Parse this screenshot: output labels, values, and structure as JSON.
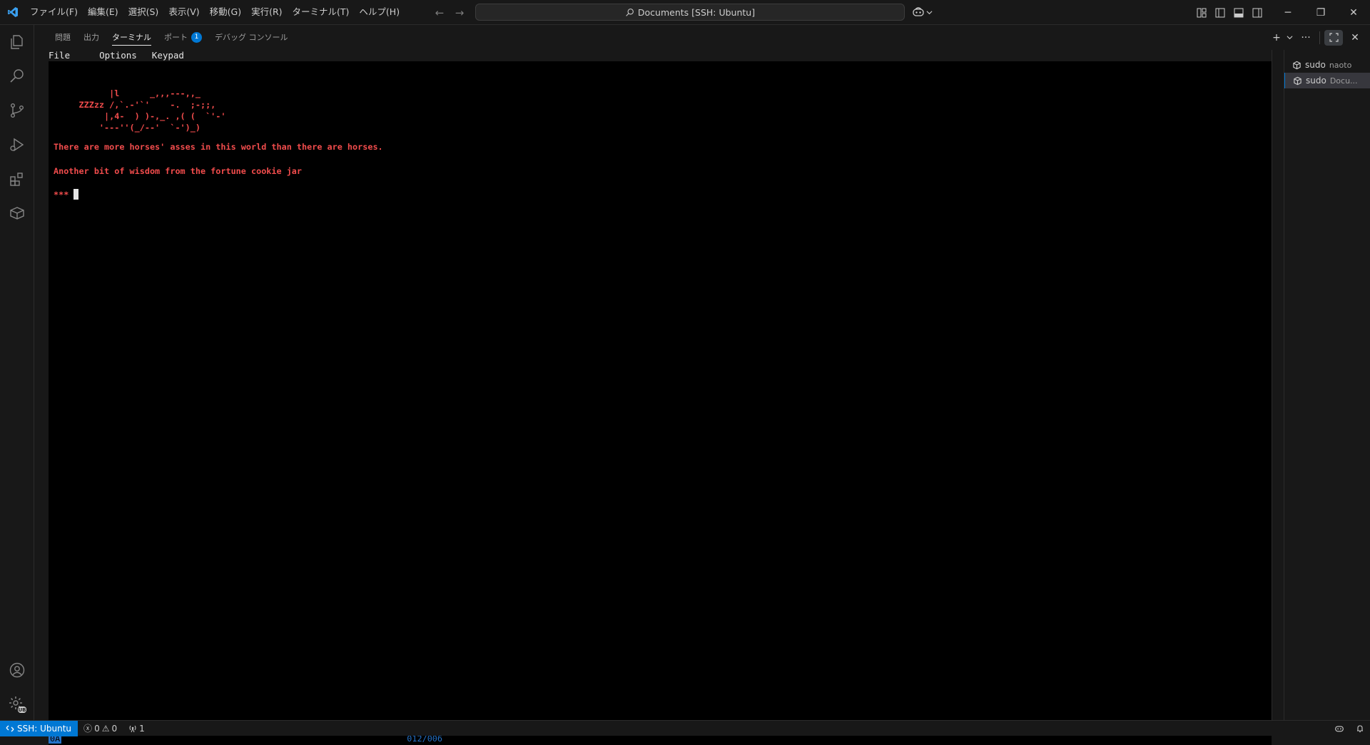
{
  "window": {
    "menu": [
      "ファイル(F)",
      "編集(E)",
      "選択(S)",
      "表示(V)",
      "移動(G)",
      "実行(R)",
      "ターミナル(T)",
      "ヘルプ(H)"
    ],
    "command_center": "Documents [SSH: Ubuntu]"
  },
  "panel": {
    "tabs": [
      "問題",
      "出力",
      "ターミナル",
      "ポート",
      "デバッグ コンソール"
    ],
    "active_tab": "ターミナル",
    "ports_badge": "1"
  },
  "terminal": {
    "mc_menu": [
      "File",
      "Options",
      "Keypad"
    ],
    "ascii_art": [
      "           |l      _,,,---,,_",
      "     ZZZzz /,`.-'`'    -.  ;-;;,",
      "          |,4-  ) )-,_. ,( (  `'-'",
      "         '---''(_/--'  `-')_)"
    ],
    "fortune": "There are more horses' asses in this world than there are horses.",
    "wisdom": "Another bit of wisdom from the fortune cookie jar",
    "prompt": "***",
    "status_left": "0A",
    "status_right": "012/006"
  },
  "terminal_list": [
    {
      "name": "sudo",
      "desc": "naoto"
    },
    {
      "name": "sudo",
      "desc": "Docu..."
    }
  ],
  "statusbar": {
    "remote": "SSH: Ubuntu",
    "errors": "0",
    "warnings": "0",
    "ports": "1"
  },
  "colors": {
    "accent": "#0078d4",
    "terminal_red": "#f14c4c",
    "terminal_blue": "#2472c8"
  }
}
